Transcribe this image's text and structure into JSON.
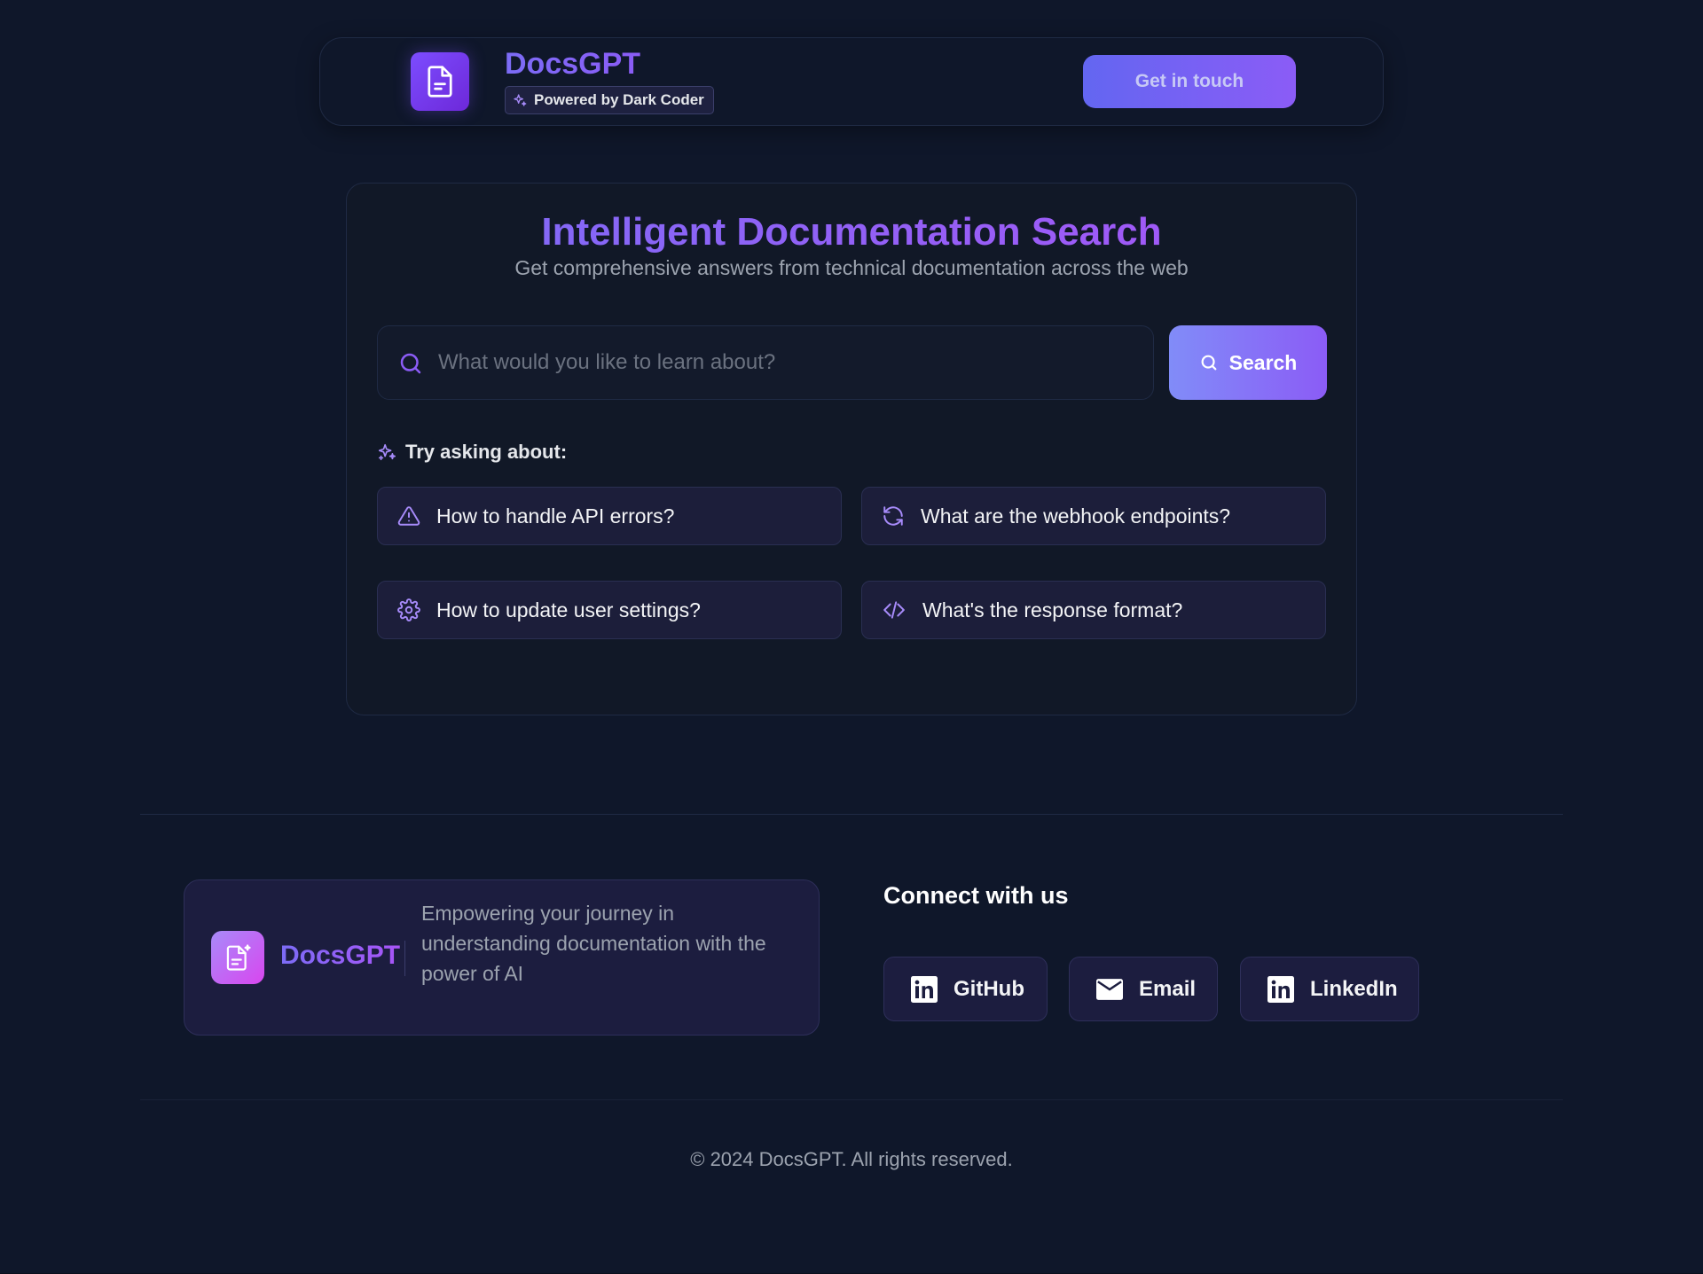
{
  "header": {
    "brand_name": "DocsGPT",
    "powered_by": "Powered by Dark Coder",
    "cta_label": "Get in touch"
  },
  "hero": {
    "title": "Intelligent Documentation Search",
    "subtitle": "Get comprehensive answers from technical documentation across the web"
  },
  "search": {
    "placeholder": "What would you like to learn about?",
    "value": "",
    "button_label": "Search"
  },
  "suggestions": {
    "label": "Try asking about:",
    "items": [
      {
        "label": "How to handle API errors?",
        "icon": "warning-icon"
      },
      {
        "label": "What are the webhook endpoints?",
        "icon": "refresh-icon"
      },
      {
        "label": "How to update user settings?",
        "icon": "gear-icon"
      },
      {
        "label": "What's the response format?",
        "icon": "code-icon"
      }
    ]
  },
  "footer": {
    "brand_name": "DocsGPT",
    "tagline": "Empowering your journey in understanding documentation with the power of AI",
    "connect_title": "Connect with us",
    "links": [
      {
        "label": "GitHub",
        "icon": "linkedin-icon"
      },
      {
        "label": "Email",
        "icon": "mail-icon"
      },
      {
        "label": "LinkedIn",
        "icon": "linkedin-icon"
      }
    ],
    "copyright": "© 2024 DocsGPT. All rights reserved."
  },
  "colors": {
    "background": "#0f172a",
    "accent": "#8b5cf6",
    "accent_blue": "#6366f1",
    "card": "#111827",
    "chip": "#1c1e3a"
  }
}
